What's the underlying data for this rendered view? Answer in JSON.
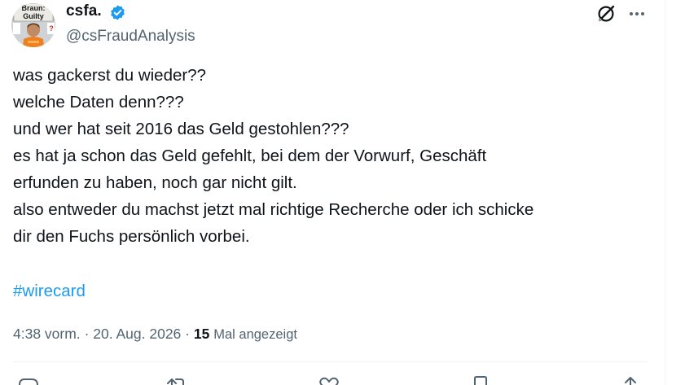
{
  "user": {
    "display_name": "csfa.",
    "handle": "@csFraudAnalysis",
    "verified": true,
    "avatar_sign_lines": [
      "Braun:",
      "Guilty"
    ]
  },
  "tweet": {
    "lines": [
      "was gackerst du wieder??",
      "welche Daten denn???",
      "und wer hat seit 2016 das Geld gestohlen???",
      "es hat ja schon das Geld gefehlt, bei dem der Vorwurf, Geschäft",
      "erfunden zu haben, noch gar nicht gilt.",
      "also entweder du machst jetzt mal richtige Recherche oder ich schicke",
      "dir den Fuchs persönlich vorbei."
    ],
    "hashtag": "#wirecard"
  },
  "meta": {
    "time": "4:38 vorm.",
    "separator": "·",
    "date": "20. Aug. 2026",
    "views_count": "15",
    "views_label": "Mal angezeigt"
  },
  "icons": {
    "verified": "verified-badge-icon",
    "grok": "grok-icon",
    "more": "more-icon",
    "reply": "reply-icon",
    "retweet": "retweet-icon",
    "like": "like-icon",
    "bookmark": "bookmark-icon",
    "share": "share-icon"
  },
  "colors": {
    "text": "#0f1419",
    "secondary": "#536471",
    "accent": "#1d9bf0",
    "divider": "#eff3f4"
  }
}
